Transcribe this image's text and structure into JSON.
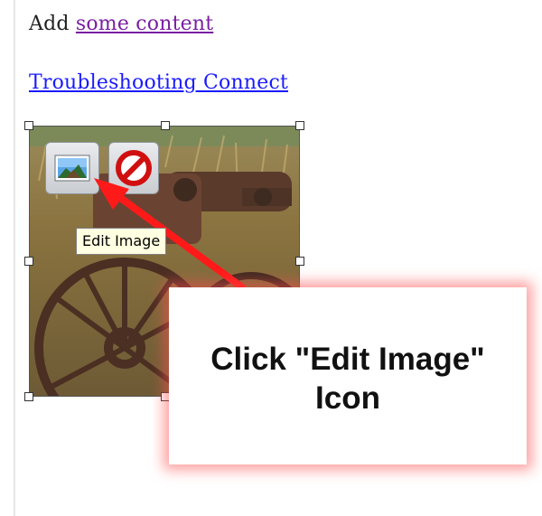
{
  "content": {
    "add_prefix": "Add ",
    "add_link": "some content",
    "troubleshoot_link": "Troubleshooting Connect"
  },
  "image_toolbar": {
    "edit_icon": "edit-image-icon",
    "delete_icon": "delete-image-icon"
  },
  "tooltip": {
    "text": "Edit Image"
  },
  "callout": {
    "line1": "Click \"Edit Image\"",
    "line2": "Icon"
  },
  "colors": {
    "link_visited": "#7a1fa2",
    "link": "#1a1aff",
    "arrow": "#ff1a1a",
    "callout_glow": "#ff5050",
    "tooltip_bg": "#ffffe1"
  }
}
